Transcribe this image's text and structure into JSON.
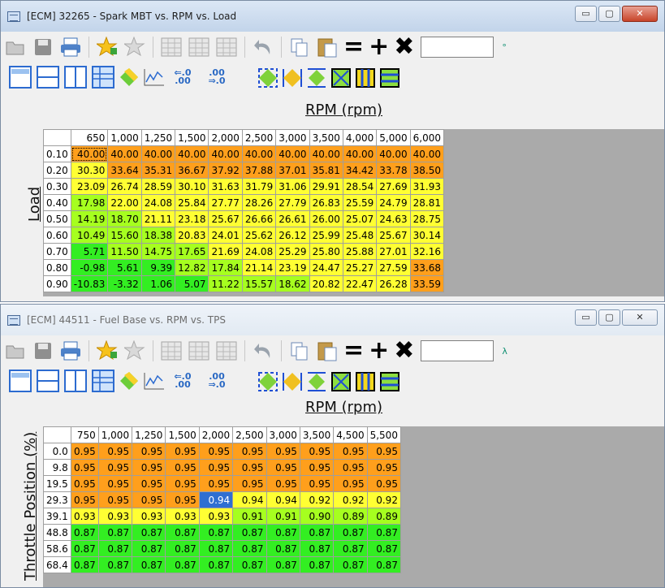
{
  "window1": {
    "title": "[ECM] 32265 - Spark MBT vs. RPM vs. Load",
    "x_axis_label": "RPM (rpm)",
    "y_axis_label": "Load",
    "unit_label": "°",
    "controls": {
      "minimize": "▭",
      "maximize": "▢",
      "close": "✕"
    },
    "columns": [
      "650",
      "1,000",
      "1,250",
      "1,500",
      "2,000",
      "2,500",
      "3,000",
      "3,500",
      "4,000",
      "5,000",
      "6,000"
    ],
    "rows": [
      {
        "label": "0.10",
        "values": [
          "40.00",
          "40.00",
          "40.00",
          "40.00",
          "40.00",
          "40.00",
          "40.00",
          "40.00",
          "40.00",
          "40.00",
          "40.00"
        ]
      },
      {
        "label": "0.20",
        "values": [
          "30.30",
          "33.64",
          "35.31",
          "36.67",
          "37.92",
          "37.88",
          "37.01",
          "35.81",
          "34.42",
          "33.78",
          "38.50"
        ]
      },
      {
        "label": "0.30",
        "values": [
          "23.09",
          "26.74",
          "28.59",
          "30.10",
          "31.63",
          "31.79",
          "31.06",
          "29.91",
          "28.54",
          "27.69",
          "31.93"
        ]
      },
      {
        "label": "0.40",
        "values": [
          "17.98",
          "22.00",
          "24.08",
          "25.84",
          "27.77",
          "28.26",
          "27.79",
          "26.83",
          "25.59",
          "24.79",
          "28.81"
        ]
      },
      {
        "label": "0.50",
        "values": [
          "14.19",
          "18.70",
          "21.11",
          "23.18",
          "25.67",
          "26.66",
          "26.61",
          "26.00",
          "25.07",
          "24.63",
          "28.75"
        ]
      },
      {
        "label": "0.60",
        "values": [
          "10.49",
          "15.60",
          "18.38",
          "20.83",
          "24.01",
          "25.62",
          "26.12",
          "25.99",
          "25.48",
          "25.67",
          "30.14"
        ]
      },
      {
        "label": "0.70",
        "values": [
          "5.71",
          "11.50",
          "14.75",
          "17.65",
          "21.69",
          "24.08",
          "25.29",
          "25.80",
          "25.88",
          "27.01",
          "32.16"
        ]
      },
      {
        "label": "0.80",
        "values": [
          "-0.98",
          "5.61",
          "9.39",
          "12.82",
          "17.84",
          "21.14",
          "23.19",
          "24.47",
          "25.27",
          "27.59",
          "33.68"
        ]
      },
      {
        "label": "0.90",
        "values": [
          "-10.83",
          "-3.32",
          "1.06",
          "5.07",
          "11.22",
          "15.57",
          "18.62",
          "20.82",
          "22.47",
          "26.28",
          "33.59"
        ]
      }
    ]
  },
  "window2": {
    "title": "[ECM] 44511 - Fuel Base vs. RPM vs. TPS",
    "x_axis_label": "RPM (rpm)",
    "y_axis_label": "Throttle Position (%)",
    "unit_label": "λ",
    "controls": {
      "minimize": "▭",
      "maximize": "▢",
      "close": "✕"
    },
    "columns": [
      "750",
      "1,000",
      "1,250",
      "1,500",
      "2,000",
      "2,500",
      "3,000",
      "3,500",
      "4,500",
      "5,500"
    ],
    "rows": [
      {
        "label": "0.0",
        "values": [
          "0.95",
          "0.95",
          "0.95",
          "0.95",
          "0.95",
          "0.95",
          "0.95",
          "0.95",
          "0.95",
          "0.95"
        ]
      },
      {
        "label": "9.8",
        "values": [
          "0.95",
          "0.95",
          "0.95",
          "0.95",
          "0.95",
          "0.95",
          "0.95",
          "0.95",
          "0.95",
          "0.95"
        ]
      },
      {
        "label": "19.5",
        "values": [
          "0.95",
          "0.95",
          "0.95",
          "0.95",
          "0.95",
          "0.95",
          "0.95",
          "0.95",
          "0.95",
          "0.95"
        ]
      },
      {
        "label": "29.3",
        "values": [
          "0.95",
          "0.95",
          "0.95",
          "0.95",
          "0.94",
          "0.94",
          "0.94",
          "0.92",
          "0.92",
          "0.92"
        ]
      },
      {
        "label": "39.1",
        "values": [
          "0.93",
          "0.93",
          "0.93",
          "0.93",
          "0.93",
          "0.91",
          "0.91",
          "0.90",
          "0.89",
          "0.89"
        ]
      },
      {
        "label": "48.8",
        "values": [
          "0.87",
          "0.87",
          "0.87",
          "0.87",
          "0.87",
          "0.87",
          "0.87",
          "0.87",
          "0.87",
          "0.87"
        ]
      },
      {
        "label": "58.6",
        "values": [
          "0.87",
          "0.87",
          "0.87",
          "0.87",
          "0.87",
          "0.87",
          "0.87",
          "0.87",
          "0.87",
          "0.87"
        ]
      },
      {
        "label": "68.4",
        "values": [
          "0.87",
          "0.87",
          "0.87",
          "0.87",
          "0.87",
          "0.87",
          "0.87",
          "0.87",
          "0.87",
          "0.87"
        ]
      }
    ]
  },
  "colors": {
    "orange": "#ff9f1c",
    "yellow": "#ffff33",
    "lime": "#a6ff1f",
    "green": "#33ee22",
    "selected": "#2f6fd1"
  },
  "icons": [
    "open-icon",
    "save-icon",
    "print-icon",
    "add-favorite-icon",
    "remove-favorite-icon",
    "table-icon",
    "undo-icon",
    "copy-icon",
    "paste-icon",
    "equals-icon",
    "plus-icon",
    "multiply-icon"
  ]
}
